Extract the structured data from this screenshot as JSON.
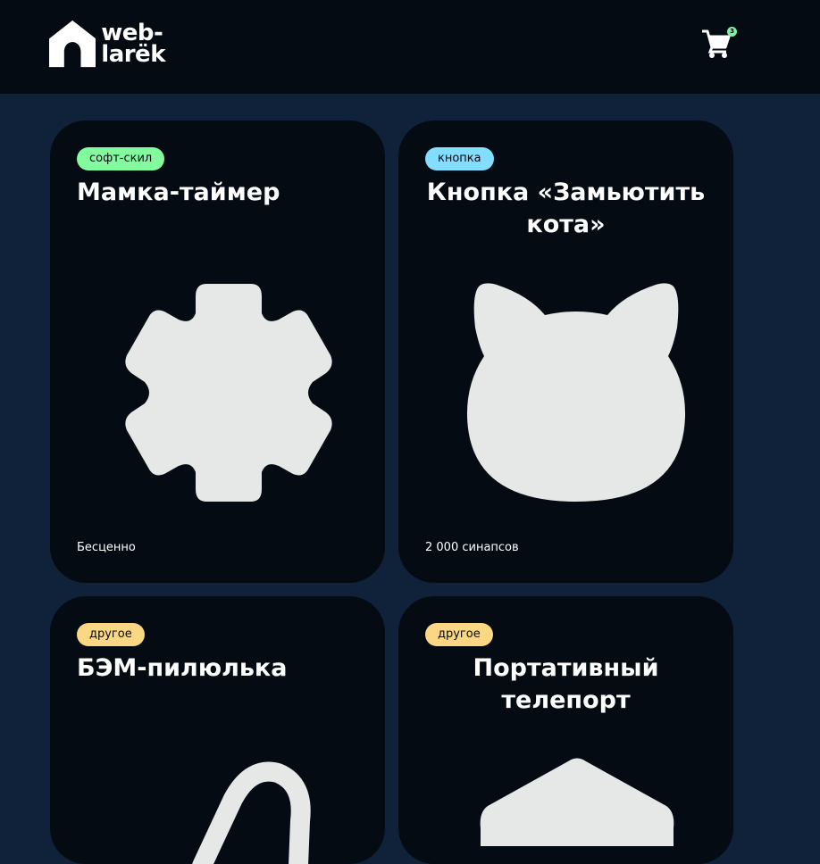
{
  "header": {
    "logo": {
      "line1": "web-",
      "line2": "larëk"
    },
    "cart": {
      "count": "3"
    }
  },
  "cards": [
    {
      "category": "софт-скил",
      "category_color": "#83fa9d",
      "title": "Мамка-таймер",
      "image": "gear-icon",
      "price": "Бесценно"
    },
    {
      "category": "кнопка",
      "category_color": "#83ddff",
      "title": "Кнопка «Замьютить кота»",
      "image": "cat-head-icon",
      "price": "2 000 синапсов"
    },
    {
      "category": "другое",
      "category_color": "#fad883",
      "title": "БЭМ-пилюлька",
      "image": "pill-icon",
      "price": ""
    },
    {
      "category": "другое",
      "category_color": "#fad883",
      "title": "Портативный телепорт",
      "image": "house-icon",
      "price": ""
    }
  ]
}
